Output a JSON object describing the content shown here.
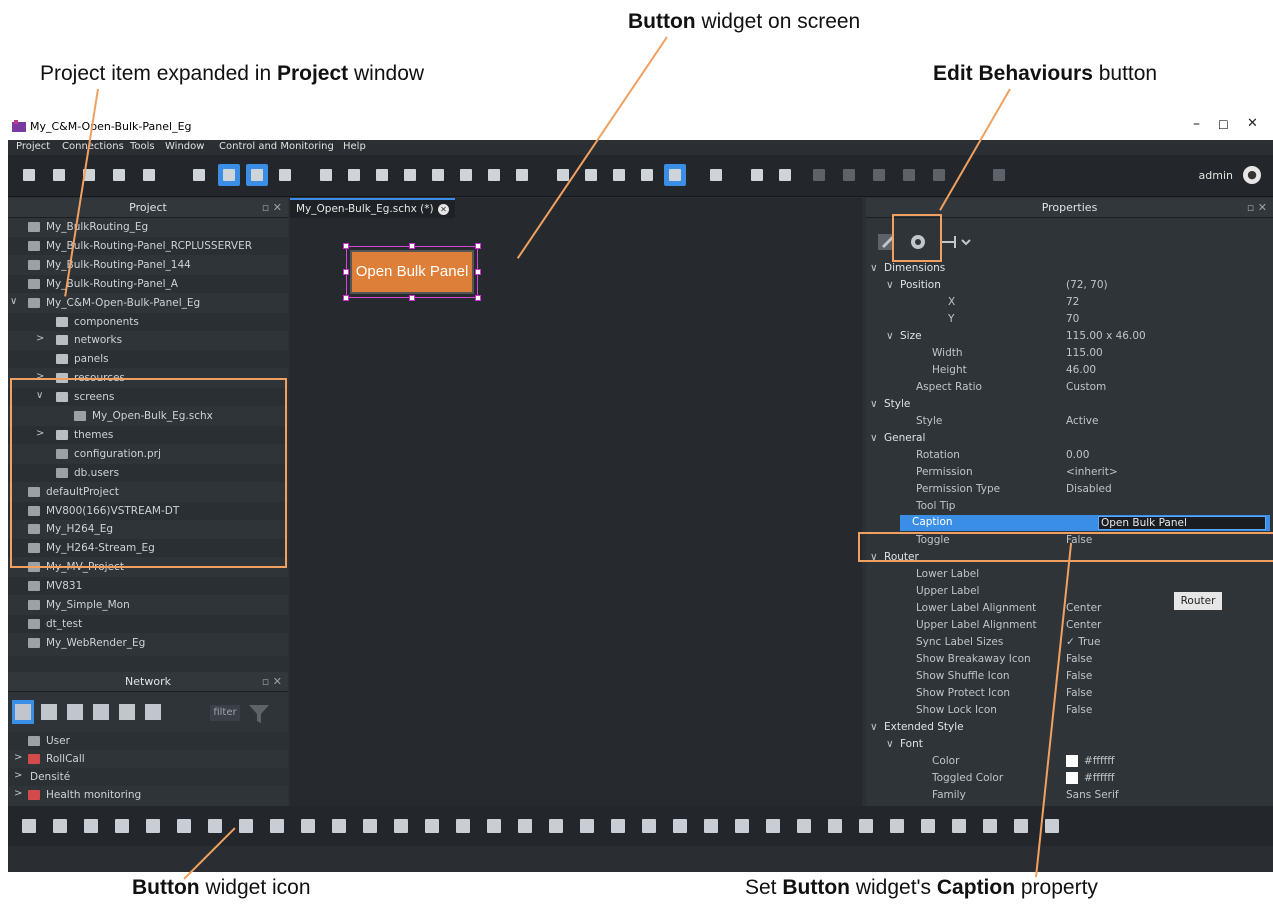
{
  "callouts": {
    "button_widget": {
      "bold": "Button",
      "rest": " widget on screen"
    },
    "project_item": {
      "pre": "Project item expanded in ",
      "bold": "Project",
      "post": " window"
    },
    "edit_behaviours": {
      "bold": "Edit Behaviours",
      "rest": " button"
    },
    "button_icon": {
      "bold": "Button",
      "rest": " widget icon"
    },
    "set_caption": {
      "pre": "Set ",
      "bold1": "Button",
      "mid": " widget's ",
      "bold2": "Caption",
      "post": " property"
    }
  },
  "window": {
    "title": "My_C&M-Open-Bulk-Panel_Eg",
    "minimize": "–",
    "maximize": "☐",
    "close": "✕"
  },
  "menu": [
    "Project",
    "Connections",
    "Tools",
    "Window",
    "Control and Monitoring",
    "Help"
  ],
  "user": {
    "name": "admin",
    "avatar_icon": "user-circle-icon"
  },
  "project_panel": {
    "title": "Project",
    "items": [
      {
        "label": "My_BulkRouting_Eg",
        "type": "project",
        "indent": 0
      },
      {
        "label": "My_Bulk-Routing-Panel_RCPLUSSERVER",
        "type": "project",
        "indent": 0
      },
      {
        "label": "My_Bulk-Routing-Panel_144",
        "type": "project",
        "indent": 0
      },
      {
        "label": "My_Bulk-Routing-Panel_A",
        "type": "project",
        "indent": 0
      },
      {
        "label": "My_C&M-Open-Bulk-Panel_Eg",
        "type": "project",
        "indent": 0,
        "expanded": true
      },
      {
        "label": "components",
        "type": "folder",
        "indent": 1
      },
      {
        "label": "networks",
        "type": "folder",
        "indent": 1,
        "collapsed": true
      },
      {
        "label": "panels",
        "type": "folder",
        "indent": 1
      },
      {
        "label": "resources",
        "type": "folder",
        "indent": 1,
        "collapsed": true
      },
      {
        "label": "screens",
        "type": "folder",
        "indent": 1,
        "expanded": true
      },
      {
        "label": "My_Open-Bulk_Eg.schx",
        "type": "file",
        "indent": 2
      },
      {
        "label": "themes",
        "type": "folder",
        "indent": 1,
        "collapsed": true
      },
      {
        "label": "configuration.prj",
        "type": "file",
        "indent": 1
      },
      {
        "label": "db.users",
        "type": "users",
        "indent": 1
      },
      {
        "label": "defaultProject",
        "type": "project",
        "indent": 0
      },
      {
        "label": "MV800(166)VSTREAM-DT",
        "type": "project",
        "indent": 0
      },
      {
        "label": "My_H264_Eg",
        "type": "project",
        "indent": 0
      },
      {
        "label": "My_H264-Stream_Eg",
        "type": "project",
        "indent": 0
      },
      {
        "label": "My_MV_Project",
        "type": "project",
        "indent": 0
      },
      {
        "label": "MV831",
        "type": "project",
        "indent": 0
      },
      {
        "label": "My_Simple_Mon",
        "type": "project",
        "indent": 0
      },
      {
        "label": "dt_test",
        "type": "project",
        "indent": 0
      },
      {
        "label": "My_WebRender_Eg",
        "type": "project",
        "indent": 0
      }
    ]
  },
  "network_panel": {
    "title": "Network",
    "filter": "filter",
    "items": [
      {
        "label": "User",
        "collapsed": false
      },
      {
        "label": "RollCall",
        "collapsed": true
      },
      {
        "label": "Densité",
        "collapsed": true
      },
      {
        "label": "Health monitoring",
        "collapsed": true
      }
    ]
  },
  "editor": {
    "tab_label": "My_Open-Bulk_Eg.schx (*)",
    "button_caption": "Open Bulk Panel",
    "button_color": "#dd7f38"
  },
  "properties": {
    "title": "Properties",
    "rows": [
      {
        "key": "Dimensions",
        "value": "",
        "level": 0,
        "group": true
      },
      {
        "key": "Position",
        "value": "(72, 70)",
        "level": 1,
        "group": true
      },
      {
        "key": "X",
        "value": "72",
        "level": 3
      },
      {
        "key": "Y",
        "value": "70",
        "level": 3
      },
      {
        "key": "Size",
        "value": "115.00 x 46.00",
        "level": 1,
        "group": true
      },
      {
        "key": "Width",
        "value": "115.00",
        "level": 2
      },
      {
        "key": "Height",
        "value": "46.00",
        "level": 2
      },
      {
        "key": "Aspect Ratio",
        "value": "Custom",
        "level": 1
      },
      {
        "key": "Style",
        "value": "",
        "level": 0,
        "group": true
      },
      {
        "key": "Style",
        "value": "Active",
        "level": 1
      },
      {
        "key": "General",
        "value": "",
        "level": 0,
        "group": true
      },
      {
        "key": "Rotation",
        "value": "0.00",
        "level": 1
      },
      {
        "key": "Permission",
        "value": "<inherit>",
        "level": 1
      },
      {
        "key": "Permission Type",
        "value": "Disabled",
        "level": 1
      },
      {
        "key": "Tool Tip",
        "value": "",
        "level": 1
      },
      {
        "key": "Caption",
        "value": "Open Bulk Panel",
        "level": 1,
        "selected": true
      },
      {
        "key": "Toggle",
        "value": "False",
        "level": 1
      },
      {
        "key": "Router",
        "value": "",
        "level": 0,
        "group": true
      },
      {
        "key": "Lower Label",
        "value": "",
        "level": 1
      },
      {
        "key": "Upper Label",
        "value": "",
        "level": 1
      },
      {
        "key": "Lower Label Alignment",
        "value": "Center",
        "level": 1
      },
      {
        "key": "Upper Label Alignment",
        "value": "Center",
        "level": 1
      },
      {
        "key": "Sync Label Sizes",
        "value": "✓ True",
        "level": 1
      },
      {
        "key": "Show Breakaway Icon",
        "value": "False",
        "level": 1
      },
      {
        "key": "Show Shuffle Icon",
        "value": "False",
        "level": 1
      },
      {
        "key": "Show Protect Icon",
        "value": "False",
        "level": 1
      },
      {
        "key": "Show Lock Icon",
        "value": "False",
        "level": 1
      },
      {
        "key": "Extended Style",
        "value": "",
        "level": 0,
        "group": true
      },
      {
        "key": "Font",
        "value": "",
        "level": 1,
        "group": true
      },
      {
        "key": "Color",
        "value": "#ffffff",
        "level": 2,
        "swatch": true
      },
      {
        "key": "Toggled Color",
        "value": "#ffffff",
        "level": 2,
        "swatch": true
      },
      {
        "key": "Family",
        "value": "Sans Serif",
        "level": 2
      }
    ],
    "tooltip": "Router"
  }
}
